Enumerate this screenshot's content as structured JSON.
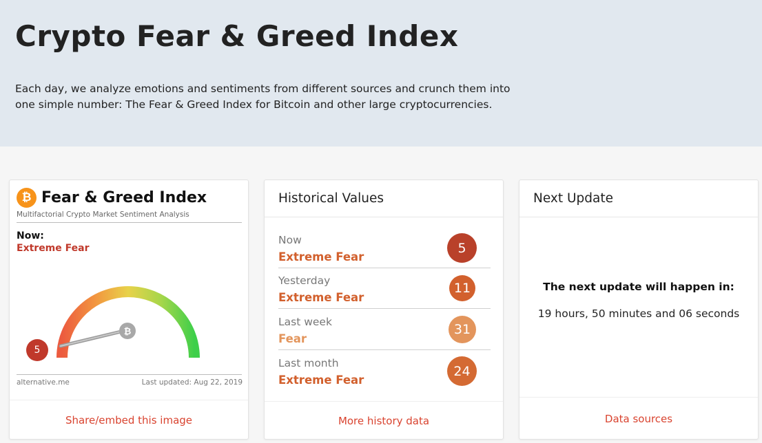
{
  "header": {
    "title": "Crypto Fear & Greed Index",
    "description": "Each day, we analyze emotions and sentiments from different sources and crunch them into one simple number: The Fear & Greed Index for Bitcoin and other large cryptocurrencies."
  },
  "gauge_card": {
    "logo_symbol": "₿",
    "title": "Fear & Greed Index",
    "subtitle": "Multifactorial Crypto Market Sentiment Analysis",
    "now_label": "Now:",
    "now_value": "Extreme Fear",
    "value": 5,
    "site": "alternative.me",
    "last_updated": "Last updated: Aug 22, 2019",
    "share_link": "Share/embed this image"
  },
  "historical": {
    "title": "Historical Values",
    "rows": [
      {
        "period": "Now",
        "label": "Extreme Fear",
        "value": "5",
        "color": "#b9412a",
        "label_color": "#d2602d"
      },
      {
        "period": "Yesterday",
        "label": "Extreme Fear",
        "value": "11",
        "color": "#d2602d",
        "label_color": "#d2602d"
      },
      {
        "period": "Last week",
        "label": "Fear",
        "value": "31",
        "color": "#e3955c",
        "label_color": "#e3955c"
      },
      {
        "period": "Last month",
        "label": "Extreme Fear",
        "value": "24",
        "color": "#d46a33",
        "label_color": "#d2602d"
      }
    ],
    "more_link": "More history data"
  },
  "next_update": {
    "title": "Next Update",
    "heading": "The next update will happen in:",
    "countdown": "19 hours, 50 minutes and 06 seconds",
    "sources_link": "Data sources"
  },
  "colors": {
    "accent_red": "#d9432f",
    "extreme_fear": "#c0392b"
  }
}
